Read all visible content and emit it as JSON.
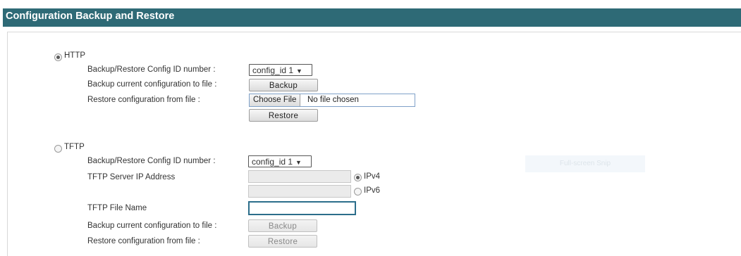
{
  "page": {
    "title": "Configuration Backup and Restore"
  },
  "http": {
    "mode_label": "HTTP",
    "selected": true,
    "config_id_label": "Backup/Restore Config ID number :",
    "config_id_value": "config_id 1",
    "backup_label": "Backup current configuration to file :",
    "backup_button": "Backup",
    "restore_label": "Restore configuration from file :",
    "choose_file_button": "Choose File",
    "file_status": "No file chosen",
    "restore_button": "Restore"
  },
  "tftp": {
    "mode_label": "TFTP",
    "selected": false,
    "config_id_label": "Backup/Restore Config ID number :",
    "config_id_value": "config_id 1",
    "server_ip_label": "TFTP Server IP Address",
    "ipv4_label": "IPv4",
    "ipv6_label": "IPv6",
    "ipv4_value": "",
    "ipv6_value": "",
    "file_name_label": "TFTP File Name",
    "file_name_value": "",
    "backup_label": "Backup current configuration to file :",
    "backup_button": "Backup",
    "restore_label": "Restore configuration from file :",
    "restore_button": "Restore"
  },
  "overlay": {
    "text": "Full-screen Snip"
  },
  "icons": {
    "dropdown": "chevron-down-icon",
    "radio": "radio-icon"
  },
  "colors": {
    "title_bar": "#2e6a76",
    "focus_border": "#2c6e8b"
  }
}
